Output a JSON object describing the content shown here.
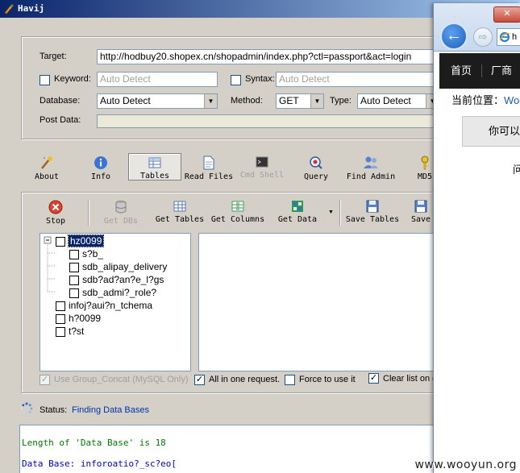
{
  "window": {
    "title": "Havij"
  },
  "target_section": {
    "target_label": "Target:",
    "target_value": "http://hodbuy20.shopex.cn/shopadmin/index.php?ctl=passport&act=login",
    "keyword_label": "Keyword:",
    "keyword_placeholder": "Auto Detect",
    "syntax_label": "Syntax:",
    "syntax_placeholder": "Auto Detect",
    "database_label": "Database:",
    "database_value": "Auto Detect",
    "method_label": "Method:",
    "method_value": "GET",
    "type_label": "Type:",
    "type_value": "Auto Detect",
    "post_data_label": "Post Data:"
  },
  "main_toolbar": [
    {
      "label": "About",
      "icon": "magic-wand-icon"
    },
    {
      "label": "Info",
      "icon": "info-icon"
    },
    {
      "label": "Tables",
      "icon": "table-icon",
      "active": true
    },
    {
      "label": "Read Files",
      "icon": "document-icon"
    },
    {
      "label": "Cmd Shell",
      "icon": "terminal-icon",
      "disabled": true
    },
    {
      "label": "Query",
      "icon": "query-icon"
    },
    {
      "label": "Find Admin",
      "icon": "admin-users-icon"
    },
    {
      "label": "MD5",
      "icon": "key-icon"
    }
  ],
  "tables_toolbar": [
    {
      "label": "Stop",
      "icon": "stop-icon"
    },
    {
      "label": "Get DBs",
      "icon": "database-icon",
      "disabled": true
    },
    {
      "label": "Get Tables",
      "icon": "get-tables-icon"
    },
    {
      "label": "Get Columns",
      "icon": "get-columns-icon"
    },
    {
      "label": "Get Data",
      "icon": "get-data-icon"
    },
    {
      "label": "Save Tables",
      "icon": "save-icon"
    },
    {
      "label": "Save",
      "icon": "save-icon"
    }
  ],
  "tree": {
    "items": [
      {
        "label": "hz0099",
        "level": 0,
        "selected": true
      },
      {
        "label": "s?b_",
        "level": 1
      },
      {
        "label": "sdb_alipay_delivery",
        "level": 1
      },
      {
        "label": "sdb?ad?an?e_l?gs",
        "level": 1
      },
      {
        "label": "sdb_admi?_role?",
        "level": 1
      },
      {
        "label": "infoj?aui?n_tchema",
        "level": 0
      },
      {
        "label": "h?0099",
        "level": 0
      },
      {
        "label": "t?st",
        "level": 0
      }
    ]
  },
  "options": {
    "group_concat": "Use Group_Concat (MySQL Only)",
    "all_in_one": "All in one request.",
    "force": "Force to use it",
    "clear_list": "Clear list on g"
  },
  "status": {
    "label": "Status:",
    "value": "Finding Data Bases"
  },
  "log": [
    "Length of 'Data Base' is 18",
    "Data Base: inforoatio?_sc?eo["
  ],
  "browser": {
    "close_symbol": "✕",
    "address_text": "h",
    "nav_items": [
      "首页",
      "厂商列"
    ],
    "crumb_label": "当前位置：",
    "crumb_link": "Woo",
    "notice_text": "你可以批",
    "question_text": "问"
  },
  "watermark": "www.wooyun.org",
  "colors": {
    "title_bar_start": "#0a246a",
    "title_bar_end": "#a6caf0",
    "status_blue": "#0033aa",
    "log_green": "#007a00",
    "log_blue": "#0000cc"
  }
}
